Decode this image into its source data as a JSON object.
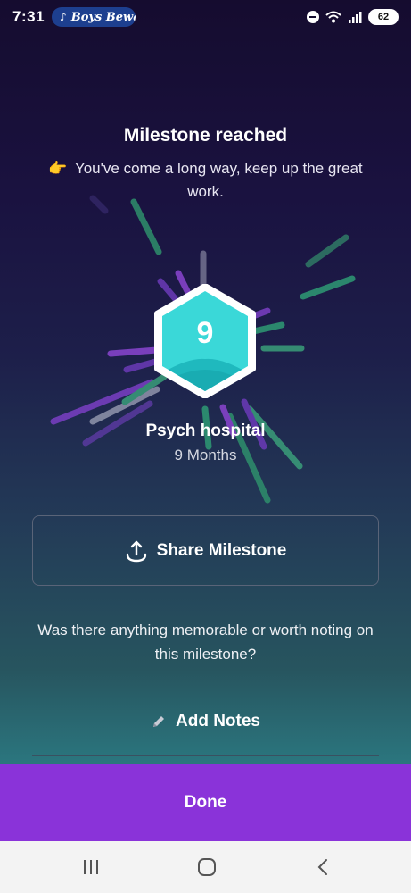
{
  "status_bar": {
    "time": "7:31",
    "media_title": "Boys Bewa",
    "battery": "62",
    "icons": [
      "music-note-icon",
      "dnd-icon",
      "wifi-icon",
      "signal-icon",
      "battery-icon"
    ]
  },
  "milestone": {
    "heading": "Milestone reached",
    "emoji": "👉",
    "message": "You've come a long way, keep up the great work.",
    "badge_number": "9",
    "name": "Psych hospital",
    "duration": "9 Months"
  },
  "share_button": {
    "label": "Share Milestone",
    "icon": "share-icon"
  },
  "notes_prompt": "Was there anything memorable or worth noting on this milestone?",
  "notes_button": {
    "label": "Add Notes",
    "icon": "pencil-icon"
  },
  "done_button": {
    "label": "Done"
  },
  "colors": {
    "accent": "#8a33d9",
    "badge_teal": "#3ad8d8",
    "burst_purple": "#7a3fc4",
    "burst_green": "#3a9e7a"
  },
  "nav_bar": {
    "icons": [
      "recents-icon",
      "home-icon",
      "back-icon"
    ]
  }
}
